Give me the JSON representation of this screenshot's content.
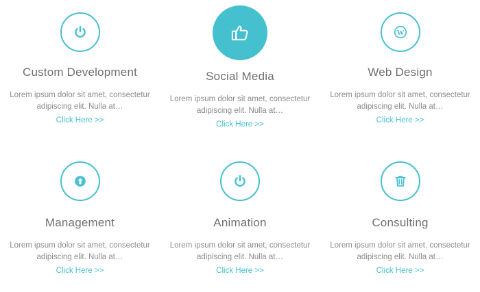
{
  "accent_color": "#45c0cf",
  "services": [
    {
      "title": "Custom Development",
      "icon": "power-icon",
      "description_line1": "Lorem ipsum dolor sit amet, consectetur",
      "description_line2": "adipiscing elit. Nulla at…",
      "link": "Click Here >>"
    },
    {
      "title": "Social Media",
      "icon": "thumbs-up-icon",
      "description_line1": "Lorem ipsum dolor sit amet, consectetur",
      "description_line2": "adipiscing elit. Nulla at…",
      "link": "Click Here >>"
    },
    {
      "title": "Web Design",
      "icon": "wordpress-icon",
      "description_line1": "Lorem ipsum dolor sit amet, consectetur",
      "description_line2": "adipiscing elit. Nulla at…",
      "link": "Click Here >>"
    },
    {
      "title": "Management",
      "icon": "upload-arrow-icon",
      "description_line1": "Lorem ipsum dolor sit amet, consectetur",
      "description_line2": "adipiscing elit. Nulla at…",
      "link": "Click Here >>"
    },
    {
      "title": "Animation",
      "icon": "power-icon",
      "description_line1": "Lorem ipsum dolor sit amet, consectetur",
      "description_line2": "adipiscing elit. Nulla at…",
      "link": "Click Here >>"
    },
    {
      "title": "Consulting",
      "icon": "trash-icon",
      "description_line1": "Lorem ipsum dolor sit amet, consectetur",
      "description_line2": "adipiscing elit. Nulla at…",
      "link": "Click Here >>"
    }
  ]
}
